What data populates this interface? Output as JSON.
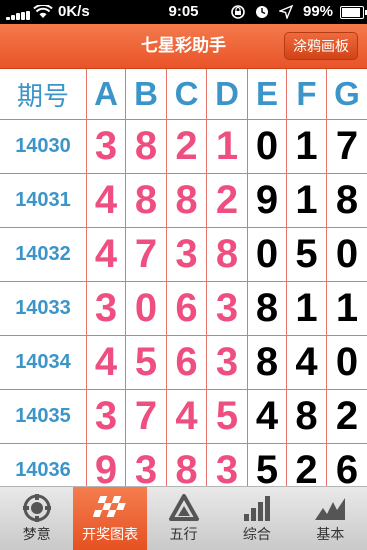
{
  "status": {
    "carrier_speed": "0K/s",
    "time": "9:05",
    "battery": "99%",
    "battery_level": 0.99
  },
  "header": {
    "title": "七星彩助手",
    "right_button": "涂鸦画板"
  },
  "table": {
    "columns": [
      "期号",
      "A",
      "B",
      "C",
      "D",
      "E",
      "F",
      "G"
    ],
    "rows": [
      {
        "period": "14030",
        "digits": [
          "3",
          "8",
          "2",
          "1",
          "0",
          "1",
          "7"
        ]
      },
      {
        "period": "14031",
        "digits": [
          "4",
          "8",
          "8",
          "2",
          "9",
          "1",
          "8"
        ]
      },
      {
        "period": "14032",
        "digits": [
          "4",
          "7",
          "3",
          "8",
          "0",
          "5",
          "0"
        ]
      },
      {
        "period": "14033",
        "digits": [
          "3",
          "0",
          "6",
          "3",
          "8",
          "1",
          "1"
        ]
      },
      {
        "period": "14034",
        "digits": [
          "4",
          "5",
          "6",
          "3",
          "8",
          "4",
          "0"
        ]
      },
      {
        "period": "14035",
        "digits": [
          "3",
          "7",
          "4",
          "5",
          "4",
          "8",
          "2"
        ]
      },
      {
        "period": "14036",
        "digits": [
          "9",
          "3",
          "8",
          "3",
          "5",
          "2",
          "6"
        ]
      }
    ]
  },
  "tabs": [
    {
      "label": "梦意",
      "icon": "dream-icon"
    },
    {
      "label": "开奖图表",
      "icon": "lottery-chart-icon"
    },
    {
      "label": "五行",
      "icon": "triangle-icon"
    },
    {
      "label": "综合",
      "icon": "bar-chart-icon"
    },
    {
      "label": "基本",
      "icon": "trend-icon"
    }
  ],
  "colors": {
    "accent": "#ee5a2c",
    "period_blue": "#3b95c8",
    "digit_pink": "#ee4f80",
    "grid_line": "#e4756c"
  }
}
